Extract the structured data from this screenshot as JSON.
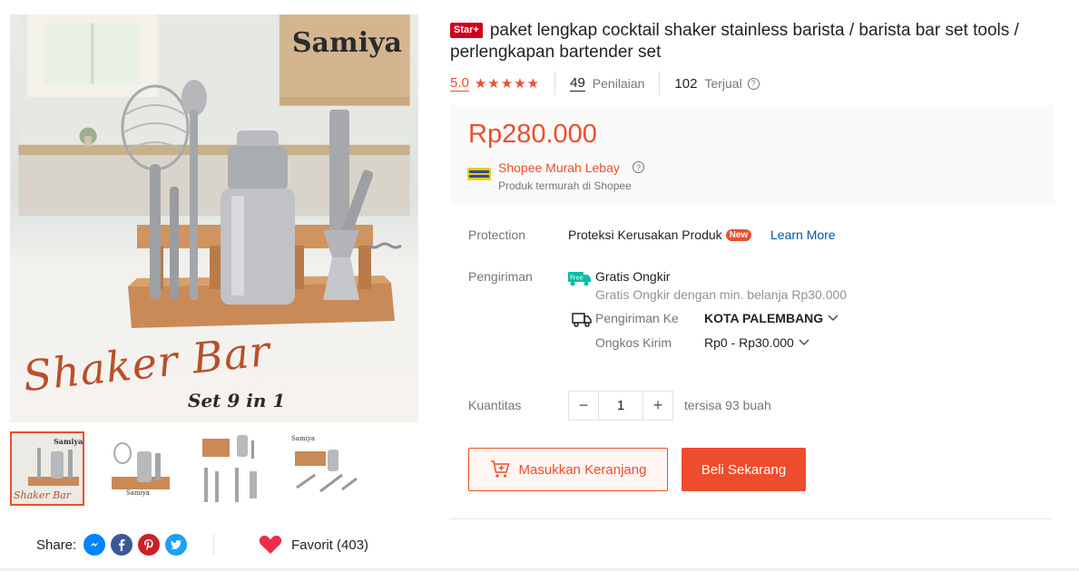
{
  "gallery": {
    "main_image": {
      "brand": "Samiya",
      "script_title": "Shaker Bar",
      "caption": "Set 9 in 1"
    },
    "thumbnails": [
      {
        "name": "thumbnail-1",
        "active": true
      },
      {
        "name": "thumbnail-2",
        "active": false
      },
      {
        "name": "thumbnail-3",
        "active": false
      },
      {
        "name": "thumbnail-4",
        "active": false
      }
    ],
    "thumb_brand": "Samiya",
    "share_label": "Share:",
    "social_icons": [
      "messenger-icon",
      "facebook-icon",
      "pinterest-icon",
      "twitter-icon"
    ],
    "favorite_label": "Favorit (403)"
  },
  "product": {
    "badge": "Star+",
    "title": "paket lengkap cocktail shaker stainless barista / barista bar set tools / perlengkapan bartender set",
    "rating": "5.0",
    "rating_stars": 5,
    "reviews_count": "49",
    "reviews_label": "Penilaian",
    "sold_count": "102",
    "sold_label": "Terjual"
  },
  "price_box": {
    "price": "Rp280.000",
    "promo_name": "Shopee Murah Lebay",
    "promo_sub": "Produk termurah di Shopee"
  },
  "protection": {
    "label": "Protection",
    "text": "Proteksi Kerusakan Produk",
    "badge": "New",
    "link": "Learn More"
  },
  "shipping": {
    "label": "Pengiriman",
    "free_badge": "Free",
    "free_title": "Gratis Ongkir",
    "free_sub": "Gratis Ongkir dengan min. belanja Rp30.000",
    "to_label": "Pengiriman Ke",
    "to_value": "KOTA PALEMBANG",
    "cost_label": "Ongkos Kirim",
    "cost_value": "Rp0 - Rp30.000"
  },
  "quantity": {
    "label": "Kuantitas",
    "value": "1",
    "minus": "−",
    "plus": "+",
    "stock": "tersisa 93 buah"
  },
  "actions": {
    "add_to_cart": "Masukkan Keranjang",
    "buy_now": "Beli Sekarang"
  },
  "colors": {
    "accent": "#ee4d2d",
    "link": "#0055aa",
    "muted": "#757575"
  }
}
